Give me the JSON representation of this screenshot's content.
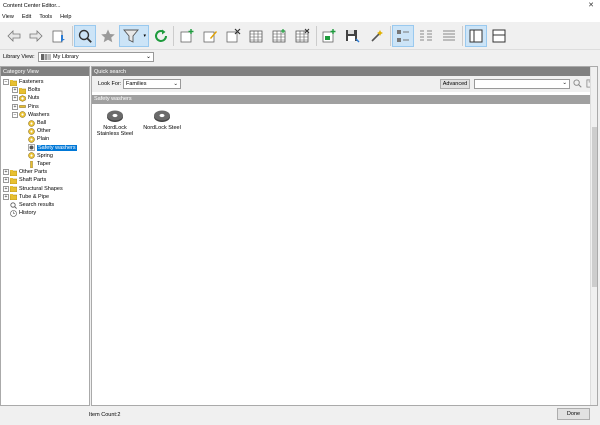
{
  "window": {
    "title": "Content Center Editor..."
  },
  "menu": [
    "View",
    "Edit",
    "Tools",
    "Help"
  ],
  "toolbar": {
    "icons": [
      "back-icon",
      "forward-icon",
      "go-up-icon",
      "search-icon",
      "favorites-icon",
      "filter-icon",
      "refresh-icon",
      "new-family-icon",
      "edit-family-icon",
      "delete-family-icon",
      "table-view-icon",
      "table-edit-icon",
      "table-delete-icon",
      "publish-icon",
      "save-icon",
      "magic-wand-icon",
      "large-icons-view",
      "list-view",
      "details-view",
      "split-view",
      "single-view"
    ]
  },
  "library": {
    "label": "Library View:",
    "value": "My Library"
  },
  "left_pane": {
    "title": "Category View",
    "tree": [
      {
        "label": "Fasteners",
        "depth": 0,
        "toggle": "−",
        "icon": "folder"
      },
      {
        "label": "Bolts",
        "depth": 1,
        "toggle": "+",
        "icon": "folder"
      },
      {
        "label": "Nuts",
        "depth": 1,
        "toggle": "+",
        "icon": "nut"
      },
      {
        "label": "Pins",
        "depth": 1,
        "toggle": "+",
        "icon": "pin"
      },
      {
        "label": "Washers",
        "depth": 1,
        "toggle": "−",
        "icon": "washer"
      },
      {
        "label": "Ball",
        "depth": 2,
        "toggle": "",
        "icon": "washer"
      },
      {
        "label": "Other",
        "depth": 2,
        "toggle": "",
        "icon": "washer"
      },
      {
        "label": "Plain",
        "depth": 2,
        "toggle": "",
        "icon": "washer"
      },
      {
        "label": "Safety washers",
        "depth": 2,
        "toggle": "",
        "icon": "safety",
        "selected": true
      },
      {
        "label": "Spring",
        "depth": 2,
        "toggle": "",
        "icon": "washer"
      },
      {
        "label": "Taper",
        "depth": 2,
        "toggle": "",
        "icon": "taper"
      },
      {
        "label": "Other Parts",
        "depth": 0,
        "toggle": "+",
        "icon": "folder"
      },
      {
        "label": "Shaft Parts",
        "depth": 0,
        "toggle": "+",
        "icon": "folder"
      },
      {
        "label": "Structural Shapes",
        "depth": 0,
        "toggle": "+",
        "icon": "folder"
      },
      {
        "label": "Tube & Pipe",
        "depth": 0,
        "toggle": "+",
        "icon": "folder"
      },
      {
        "label": "Search results",
        "depth": 0,
        "toggle": "",
        "icon": "search"
      },
      {
        "label": "History",
        "depth": 0,
        "toggle": "",
        "icon": "history"
      }
    ]
  },
  "right_pane": {
    "title": "Quick search",
    "look_for_label": "Look For:",
    "look_for_value": "Families",
    "advanced_label": "Advanced",
    "search_value": "",
    "group_title": "Safety washers",
    "families": [
      "NordLock Stainless Steel",
      "NordLock Steel"
    ]
  },
  "status": {
    "count": "Item Count:2",
    "done_label": "Done"
  }
}
